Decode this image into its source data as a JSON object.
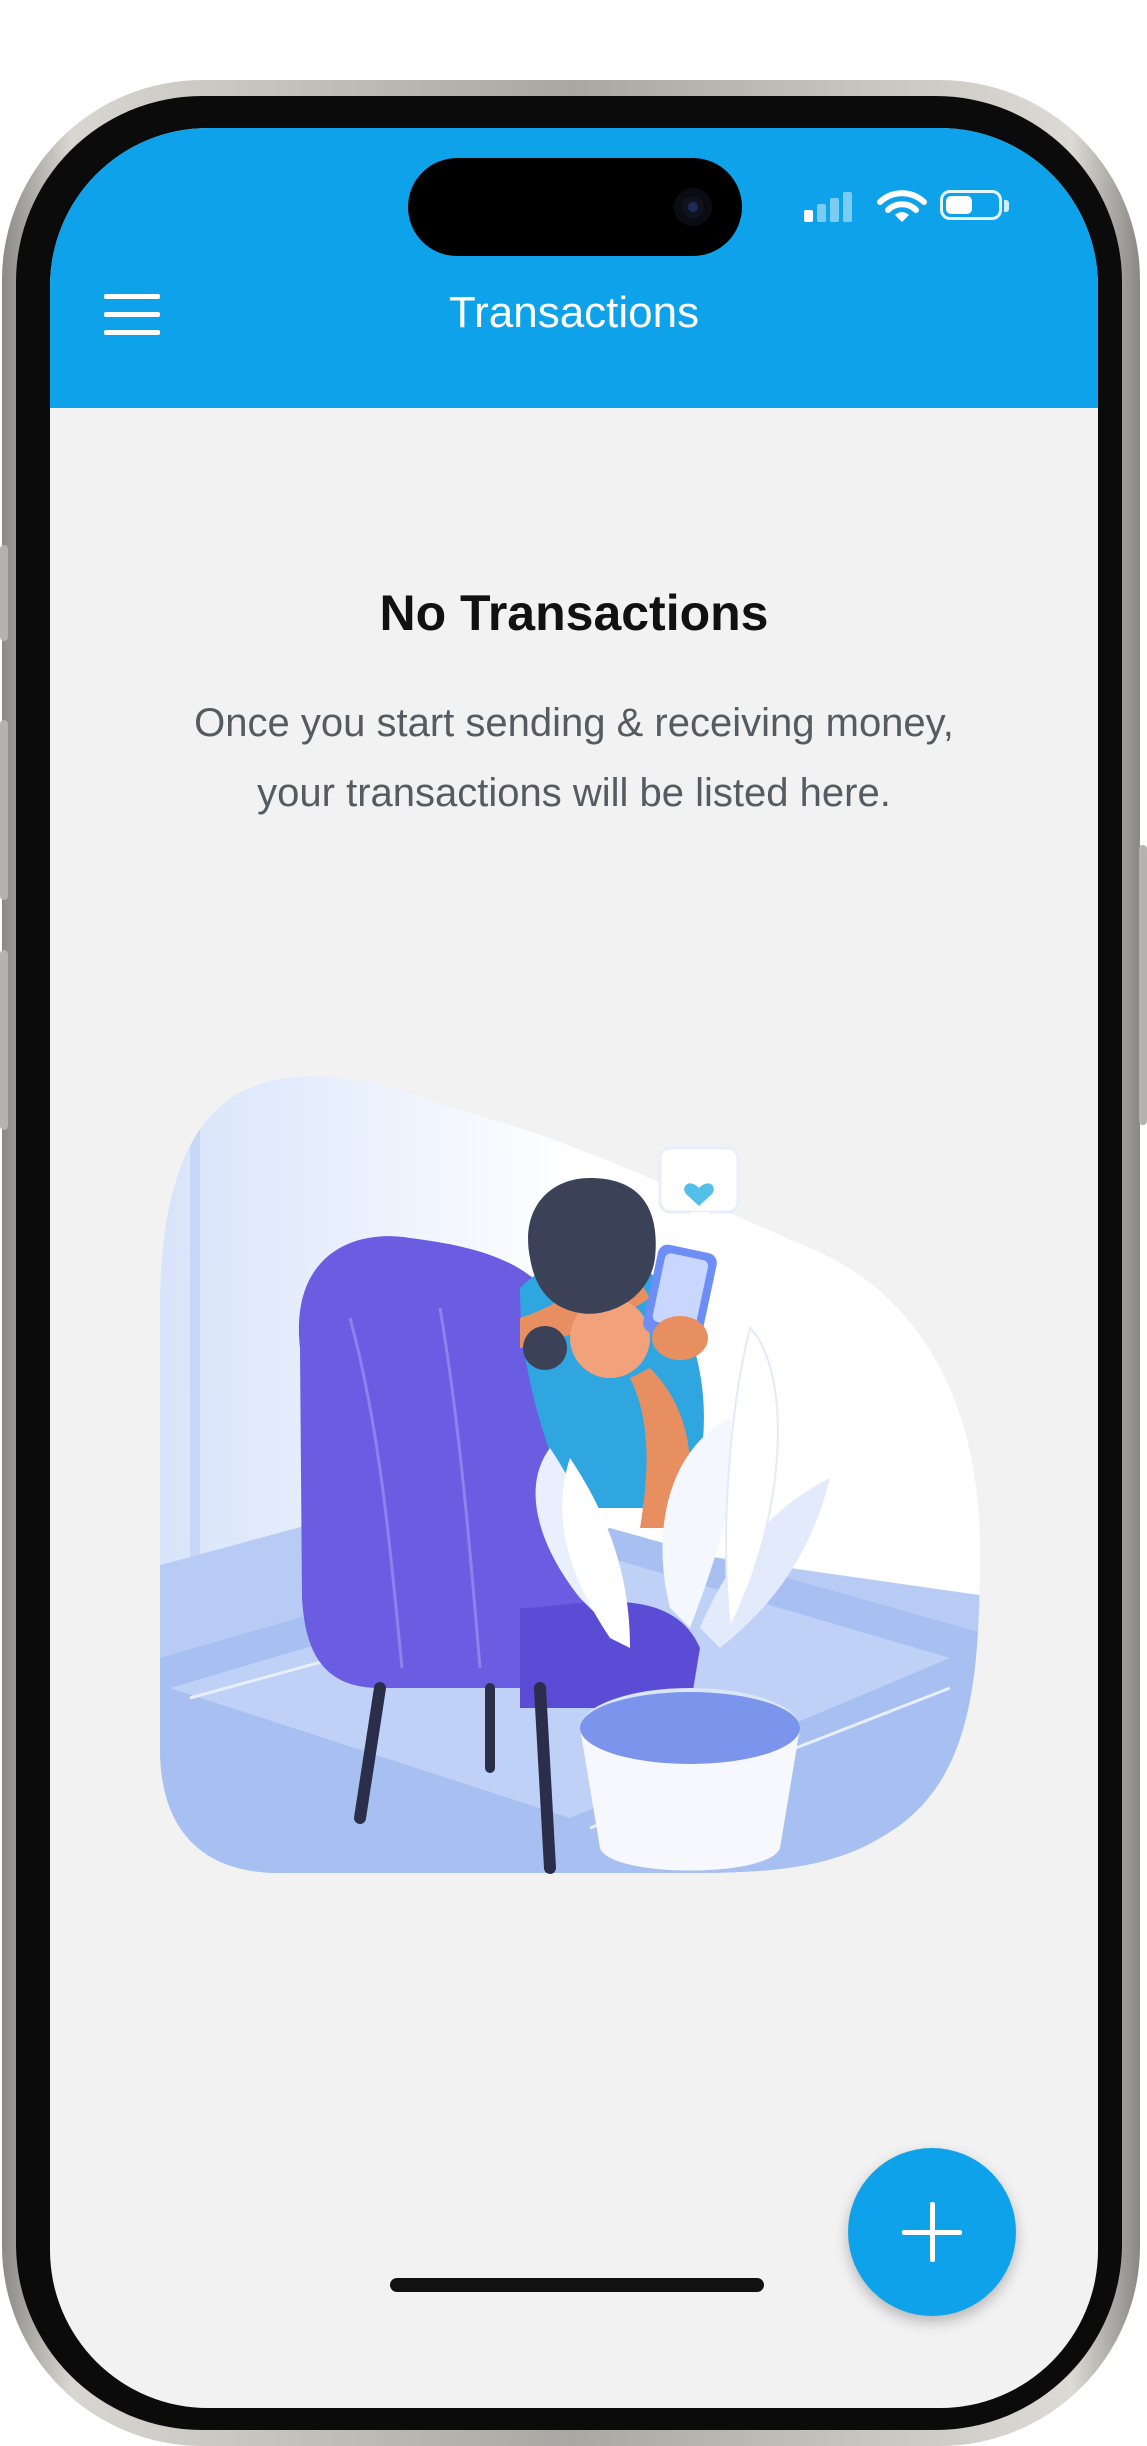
{
  "header": {
    "title": "Transactions",
    "color": "#0ea2ea",
    "menu_icon": "hamburger-menu-icon"
  },
  "status_bar": {
    "signal_icon": "cellular-signal-icon",
    "wifi_icon": "wifi-icon",
    "battery_icon": "battery-icon"
  },
  "empty_state": {
    "title": "No Transactions",
    "message": "Once you start sending & receiving money, your transactions will be listed here.",
    "illustration": "woman-in-chair-with-phone-illustration"
  },
  "fab": {
    "icon": "plus-icon",
    "color": "#0ea2ea"
  }
}
